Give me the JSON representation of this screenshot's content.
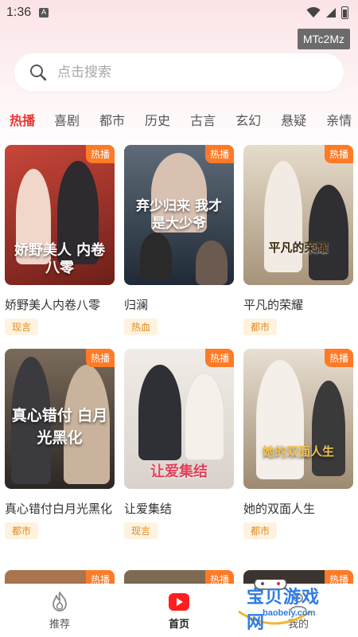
{
  "status": {
    "time": "1:36",
    "notif": "A"
  },
  "badge": "MTc2Mz",
  "search": {
    "placeholder": "点击搜索"
  },
  "tabs": [
    {
      "label": "热播",
      "active": true
    },
    {
      "label": "喜剧"
    },
    {
      "label": "都市"
    },
    {
      "label": "历史"
    },
    {
      "label": "古言"
    },
    {
      "label": "玄幻"
    },
    {
      "label": "悬疑"
    },
    {
      "label": "亲情"
    }
  ],
  "hot_label": "热播",
  "cards": [
    {
      "title": "娇野美人内卷八零",
      "genre": "现言",
      "poster_text": "娇野美人 内卷八零",
      "bg": "#8b2a22",
      "bg2": "#c9463a"
    },
    {
      "title": "归澜",
      "genre": "热血",
      "poster_text": "弃少归来 我才是大少爷",
      "bg": "#1f2a36",
      "bg2": "#5f6b78"
    },
    {
      "title": "平凡的荣耀",
      "genre": "都市",
      "poster_text": "平凡的荣耀",
      "bg": "#b9a98e",
      "bg2": "#e6dccb"
    },
    {
      "title": "真心错付白月光黑化",
      "genre": "都市",
      "poster_text": "真心错付 白月光黑化",
      "bg": "#3a3630",
      "bg2": "#7b6b5b"
    },
    {
      "title": "让爱集结",
      "genre": "现言",
      "poster_text": "让爱集结",
      "bg": "#d9d2cc",
      "bg2": "#f1ece7"
    },
    {
      "title": "她的双面人生",
      "genre": "都市",
      "poster_text": "她的双面人生",
      "bg": "#b9a48a",
      "bg2": "#e9e0d3"
    }
  ],
  "row3_hot": [
    "热播",
    "热播",
    "热播"
  ],
  "nav": [
    {
      "label": "推荐",
      "icon": "flame-icon"
    },
    {
      "label": "首页",
      "icon": "play-icon",
      "active": true
    },
    {
      "label": "我的",
      "icon": "user-icon"
    }
  ],
  "watermark": {
    "line1": "宝贝游戏网",
    "line2": "baobeiy.com"
  },
  "colors": {
    "accent": "#e53935",
    "hot": "#ff7a26",
    "genre_bg": "#fff3df",
    "genre_text": "#e08a1e"
  }
}
